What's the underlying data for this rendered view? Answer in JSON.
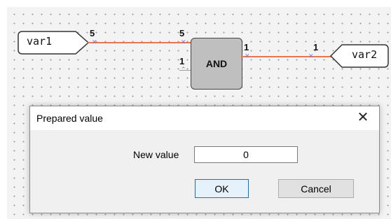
{
  "diagram": {
    "input_var": "var1",
    "output_var": "var2",
    "block": "AND",
    "pins": {
      "input_source": "5",
      "and_in1": "5",
      "and_in2": "1",
      "and_out": "1",
      "output_dest": "1"
    },
    "wire_color": "#e8764f"
  },
  "dialog": {
    "title": "Prepared value",
    "close_glyph": "✕",
    "field_label": "New value",
    "field_value": "0",
    "ok_label": "OK",
    "cancel_label": "Cancel"
  }
}
